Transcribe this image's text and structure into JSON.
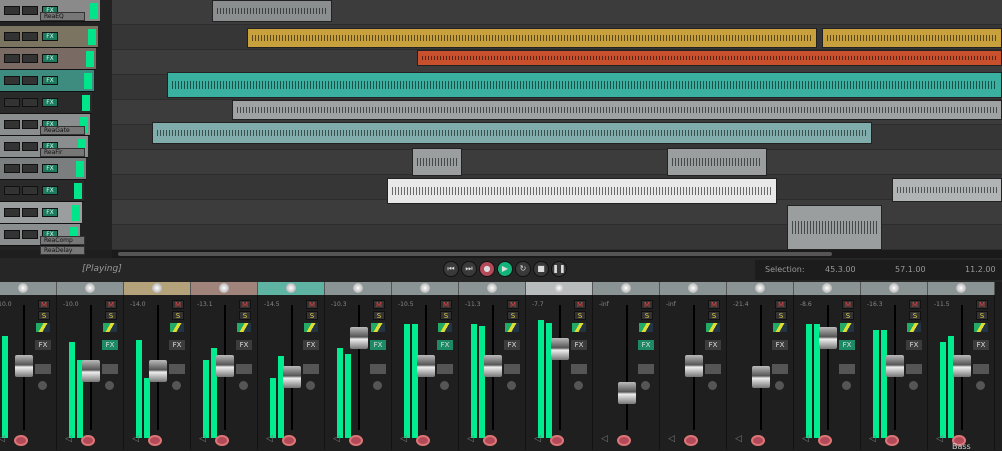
{
  "tracks": [
    {
      "color": "#8a8a8a",
      "plugins": [
        "ReaEQ"
      ]
    },
    {
      "color": "#7a7460",
      "plugins": []
    },
    {
      "color": "#7a6a64",
      "plugins": []
    },
    {
      "color": "#3e8c80",
      "plugins": []
    },
    {
      "color": "#2a2a2a",
      "plugins": []
    },
    {
      "color": "#8a8e8e",
      "plugins": [
        "ReaGate"
      ]
    },
    {
      "color": "#8a8e8e",
      "plugins": [
        "ReaFir"
      ]
    },
    {
      "color": "#7a7e7e",
      "plugins": []
    },
    {
      "color": "#2a2a2a",
      "plugins": []
    },
    {
      "color": "#9a9e9e",
      "plugins": []
    },
    {
      "color": "#8a8e8e",
      "plugins": [
        "ReaComp",
        "ReaDelay"
      ]
    }
  ],
  "track_buttons": {
    "fx": "FX"
  },
  "clips": [
    {
      "lane": 0,
      "color": "#8a8e8e"
    },
    {
      "lane": 1,
      "color": "#c8a03c"
    },
    {
      "lane": 1,
      "color": "#c8a03c"
    },
    {
      "lane": 2,
      "color": "#c8502c"
    },
    {
      "lane": 3,
      "color": "#3ab0a0"
    },
    {
      "lane": 4,
      "color": "#9ea2a2"
    },
    {
      "lane": 5,
      "color": "#80acac"
    },
    {
      "lane": 6,
      "color": "#9a9e9e"
    },
    {
      "lane": 6,
      "color": "#9a9e9e"
    },
    {
      "lane": 7,
      "color": "#e8e8e8"
    },
    {
      "lane": 7,
      "color": "#b0b4b4"
    },
    {
      "lane": 8,
      "color": "#9a9e9e"
    }
  ],
  "colors": {
    "meter": "#00ec8e",
    "play": "#12b37a",
    "record": "#b34a5a",
    "edit_cursor": "#d04040",
    "play_cursor": "#e0c040"
  },
  "transport": {
    "status": "[Playing]",
    "buttons": [
      {
        "name": "go-start",
        "icon": "⏮"
      },
      {
        "name": "go-end",
        "icon": "⏭"
      },
      {
        "name": "record",
        "icon": "●"
      },
      {
        "name": "play",
        "icon": "▶"
      },
      {
        "name": "repeat",
        "icon": "↻"
      },
      {
        "name": "stop",
        "icon": "■"
      },
      {
        "name": "pause",
        "icon": "❚❚"
      }
    ]
  },
  "selection": {
    "label": "Selection:",
    "start": "45.3.00",
    "end": "57.1.00",
    "length": "11.2.00"
  },
  "mixer": {
    "mute": "M",
    "solo": "S",
    "fx": "FX",
    "strips": [
      {
        "db": "-10.0",
        "knob": "#8a9494",
        "fx_on": false,
        "fader": 0.55,
        "meters": [
          0.85,
          0
        ]
      },
      {
        "db": "-10.0",
        "knob": "#8a9494",
        "fx_on": true,
        "fader": 0.5,
        "meters": [
          0.8,
          0.65
        ]
      },
      {
        "db": "-14.0",
        "knob": "#b3a27a",
        "fx_on": false,
        "fader": 0.5,
        "meters": [
          0.82,
          0.5
        ]
      },
      {
        "db": "-13.1",
        "knob": "#a0847c",
        "fx_on": false,
        "fader": 0.55,
        "meters": [
          0.65,
          0.75
        ]
      },
      {
        "db": "-14.5",
        "knob": "#5fb3a3",
        "fx_on": false,
        "fader": 0.45,
        "meters": [
          0.5,
          0.68
        ]
      },
      {
        "db": "-10.3",
        "knob": "#8a9494",
        "fx_on": true,
        "fader": 0.8,
        "meters": [
          0.75,
          0.7
        ]
      },
      {
        "db": "-10.5",
        "knob": "#8a9494",
        "fx_on": true,
        "fader": 0.55,
        "meters": [
          0.95,
          0.95
        ]
      },
      {
        "db": "-11.3",
        "knob": "#8a9494",
        "fx_on": false,
        "fader": 0.55,
        "meters": [
          0.95,
          0.93
        ]
      },
      {
        "db": "-7.7",
        "knob": "#b8bcbc",
        "fx_on": false,
        "fader": 0.7,
        "meters": [
          0.98,
          0.96
        ]
      },
      {
        "db": "-inf",
        "knob": "#8a9494",
        "fx_on": true,
        "fader": 0.3,
        "meters": [
          0,
          0
        ]
      },
      {
        "db": "-inf",
        "knob": "#8a9494",
        "fx_on": false,
        "fader": 0.55,
        "meters": [
          0,
          0
        ]
      },
      {
        "db": "-21.4",
        "knob": "#8a9494",
        "fx_on": false,
        "fader": 0.45,
        "meters": [
          0,
          0
        ]
      },
      {
        "db": "-8.6",
        "knob": "#8a9494",
        "fx_on": true,
        "fader": 0.8,
        "meters": [
          0.95,
          0.95
        ]
      },
      {
        "db": "-16.3",
        "knob": "#8a9494",
        "fx_on": false,
        "fader": 0.55,
        "meters": [
          0.9,
          0.9
        ]
      },
      {
        "db": "-11.5",
        "knob": "#8a9494",
        "fx_on": false,
        "fader": 0.55,
        "meters": [
          0.8,
          0.85
        ],
        "name": "Bass"
      }
    ]
  }
}
